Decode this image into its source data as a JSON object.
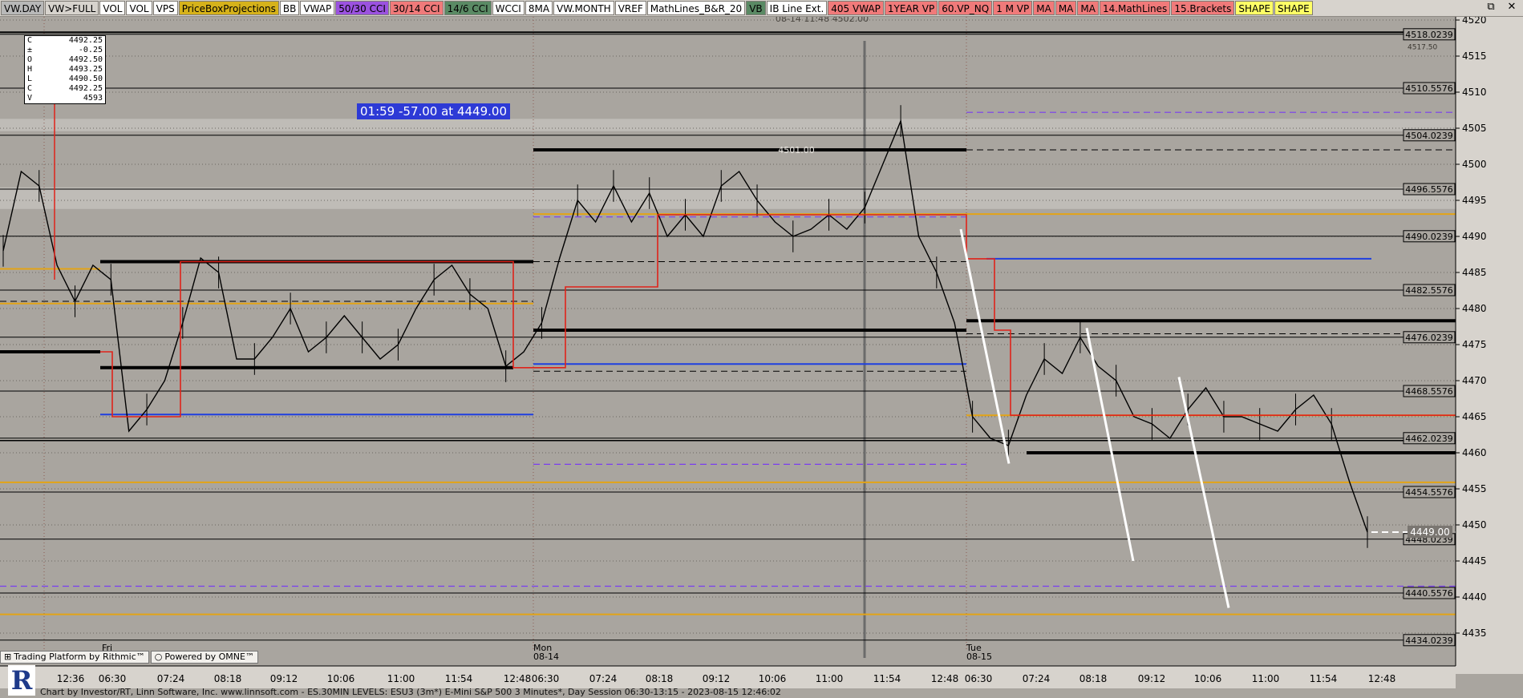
{
  "toolbar": {
    "buttons": [
      {
        "label": "VW.DAY",
        "bg": "#b8b8b8"
      },
      {
        "label": "VW>FULL",
        "bg": "#d7d3cd"
      },
      {
        "label": "VOL",
        "bg": "#ffffff"
      },
      {
        "label": "VOL",
        "bg": "#ffffff"
      },
      {
        "label": "VPS",
        "bg": "#ffffff"
      },
      {
        "label": "PriceBoxProjections",
        "bg": "#d6b21a"
      },
      {
        "label": "BB",
        "bg": "#ffffff"
      },
      {
        "label": "VWAP",
        "bg": "#ffffff"
      },
      {
        "label": "50/30 CCI",
        "bg": "#9b52e0"
      },
      {
        "label": "30/14 CCI",
        "bg": "#f07a7a"
      },
      {
        "label": "14/6 CCI",
        "bg": "#5a8a64"
      },
      {
        "label": "WCCI",
        "bg": "#ffffff"
      },
      {
        "label": "8MA",
        "bg": "#ffffff"
      },
      {
        "label": "VW.MONTH",
        "bg": "#ffffff"
      },
      {
        "label": "VREF",
        "bg": "#ffffff"
      },
      {
        "label": "MathLines_B&R_20",
        "bg": "#ffffff"
      },
      {
        "label": "VB",
        "bg": "#5a8a64"
      },
      {
        "label": "IB Line Ext.",
        "bg": "#ffffff"
      },
      {
        "label": "405 VWAP",
        "bg": "#f07a7a"
      },
      {
        "label": "1YEAR VP",
        "bg": "#f07a7a"
      },
      {
        "label": "60.VP_NQ",
        "bg": "#f07a7a"
      },
      {
        "label": "1 M VP",
        "bg": "#f07a7a"
      },
      {
        "label": "MA",
        "bg": "#f07a7a"
      },
      {
        "label": "MA",
        "bg": "#f07a7a"
      },
      {
        "label": "MA",
        "bg": "#f07a7a"
      },
      {
        "label": "14.MathLines",
        "bg": "#f07a7a"
      },
      {
        "label": "15.Brackets",
        "bg": "#f07a7a"
      },
      {
        "label": "SHAPE",
        "bg": "#ffff66"
      },
      {
        "label": "SHAPE",
        "bg": "#ffff66"
      }
    ]
  },
  "window_controls": {
    "restore": "⧉",
    "close": "✕"
  },
  "ohlc": [
    {
      "k": "C",
      "v": "4492.25"
    },
    {
      "k": "±",
      "v": "-0.25"
    },
    {
      "k": "O",
      "v": "4492.50"
    },
    {
      "k": "H",
      "v": "4493.25"
    },
    {
      "k": "L",
      "v": "4490.50"
    },
    {
      "k": "C",
      "v": "4492.25"
    },
    {
      "k": "V",
      "v": "4593"
    }
  ],
  "countdown": "01:59  -57.00 at 4449.00",
  "annotations": {
    "top_marker": "08-14 11:48  4502.00",
    "mid_marker": "4501.00"
  },
  "price_axis": {
    "ticks": [
      4520,
      4515,
      4510,
      4505,
      4500,
      4495,
      4490,
      4485,
      4480,
      4475,
      4470,
      4465,
      4460,
      4455,
      4450,
      4445,
      4440,
      4435
    ],
    "level_labels": [
      "4518.0239",
      "4510.5576",
      "4504.0239",
      "4496.5576",
      "4490.0239",
      "4482.5576",
      "4476.0239",
      "4468.5576",
      "4462.0239",
      "4454.5576",
      "4448.0239",
      "4440.5576",
      "4434.0239"
    ],
    "level_values": [
      4518.0239,
      4510.5576,
      4504.0239,
      4496.5576,
      4490.0239,
      4482.5576,
      4476.0239,
      4468.5576,
      4462.0239,
      4454.5576,
      4448.0239,
      4440.5576,
      4434.0239
    ],
    "small_label": "4517.50",
    "current_price": "4449.00",
    "current_value": 4449.0
  },
  "time_axis": {
    "labels": [
      "12:36",
      "06:30",
      "07:24",
      "08:18",
      "09:12",
      "10:06",
      "11:00",
      "11:54",
      "12:48",
      "06:30",
      "07:24",
      "08:18",
      "09:12",
      "10:06",
      "11:00",
      "11:54",
      "12:48",
      "06:30",
      "07:24",
      "08:18",
      "09:12",
      "10:06",
      "11:00",
      "11:54",
      "12:48"
    ],
    "days": [
      {
        "name": "Fri",
        "date": ""
      },
      {
        "name": "Mon",
        "date": "08-14"
      },
      {
        "name": "Tue",
        "date": "08-15"
      }
    ]
  },
  "brand": {
    "rithmic": "Trading Platform by Rithmic™",
    "omne": "Powered by OMNE™",
    "logo": "R"
  },
  "footer": "Chart by Investor/RT, Linn Software, Inc. www.linnsoft.com - ES.30MIN LEVELS: ESU3 (3m*) E-Mini S&P 500 3 Minutes*, Day Session 06:30-13:15 - 2023-08-15 12:46:02",
  "colors": {
    "background": "#a9a59f",
    "vwap": "#e0231a",
    "support": "#000000",
    "blue_level": "#1f3fe0",
    "orange_level": "#e3a416",
    "purple_level": "#7a3df0",
    "trend": "#ffffff"
  },
  "chart_data": {
    "type": "line",
    "ylim": [
      4432,
      4522
    ],
    "levels": [
      {
        "name": "4518.0239",
        "value": 4518.0239
      },
      {
        "name": "4510.5576",
        "value": 4510.5576
      },
      {
        "name": "4504.0239",
        "value": 4504.0239
      },
      {
        "name": "4496.5576",
        "value": 4496.5576
      },
      {
        "name": "4490.0239",
        "value": 4490.0239
      },
      {
        "name": "4482.5576",
        "value": 4482.5576
      },
      {
        "name": "4476.0239",
        "value": 4476.0239
      },
      {
        "name": "4468.5576",
        "value": 4468.5576
      },
      {
        "name": "4462.0239",
        "value": 4462.0239
      },
      {
        "name": "4454.5576",
        "value": 4454.5576
      },
      {
        "name": "4448.0239",
        "value": 4448.0239
      },
      {
        "name": "4440.5576",
        "value": 4440.5576
      },
      {
        "name": "4434.0239",
        "value": 4434.0239
      }
    ],
    "close_path": [
      4488,
      4499,
      4497,
      4486,
      4481,
      4486,
      4484,
      4463,
      4466,
      4470,
      4478,
      4487,
      4485,
      4473,
      4473,
      4476,
      4480,
      4474,
      4476,
      4479,
      4476,
      4473,
      4475,
      4480,
      4484,
      4486,
      4482,
      4480,
      4472,
      4474,
      4478,
      4487,
      4495,
      4492,
      4497,
      4492,
      4496,
      4490,
      4493,
      4490,
      4497,
      4499,
      4495,
      4492,
      4490,
      4491,
      4493,
      4491,
      4494,
      4500,
      4506,
      4490,
      4485,
      4478,
      4465,
      4462,
      4461,
      4468,
      4473,
      4471,
      4476,
      4472,
      4470,
      4465,
      4464,
      4462,
      4466,
      4469,
      4465,
      4465,
      4464,
      4463,
      4466,
      4468,
      4464,
      4456,
      4449
    ]
  }
}
